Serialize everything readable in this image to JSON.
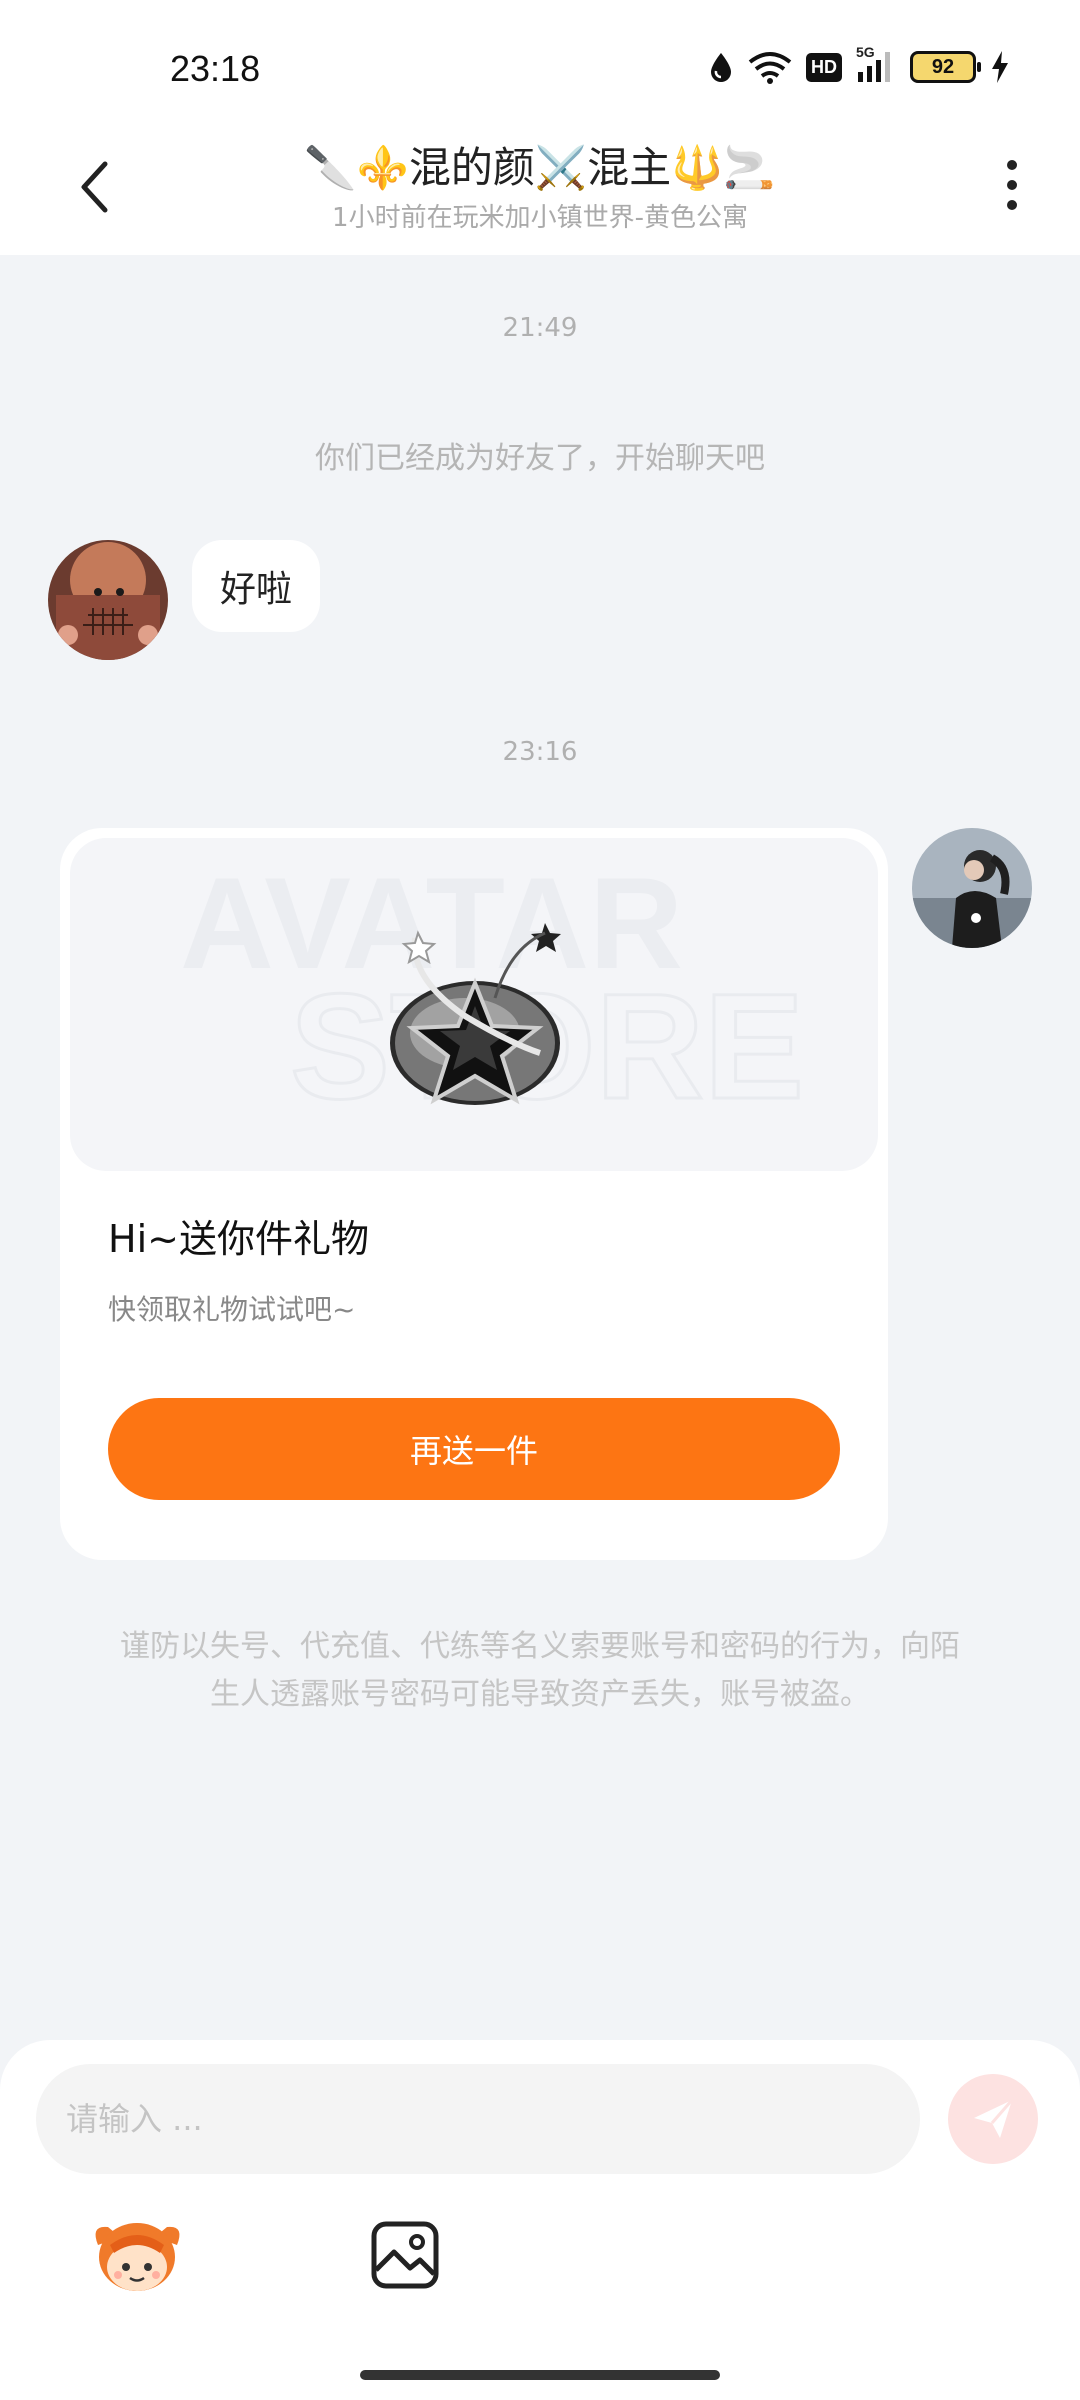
{
  "status_bar": {
    "time": "23:18",
    "network": "5G",
    "hd": "HD",
    "battery": "92"
  },
  "header": {
    "title": "🔪⚜️混的颜⚔️混主🔱🚬",
    "subtitle": "1小时前在玩米加小镇世界-黄色公寓"
  },
  "chat": {
    "time_1": "21:49",
    "system_message": "你们已经成为好友了，开始聊天吧",
    "message_1": "好啦",
    "time_2": "23:16",
    "gift": {
      "watermark_top": "AVATAR",
      "watermark_bottom": "STORE",
      "title": "Hi~送你件礼物",
      "description": "快领取礼物试试吧~",
      "button": "再送一件"
    },
    "warning": "谨防以失号、代充值、代练等名义索要账号和密码的行为，向陌生人透露账号密码可能导致资产丢失，账号被盗。"
  },
  "input": {
    "placeholder": "请输入 ..."
  },
  "colors": {
    "accent": "#fd7513",
    "background": "#f2f4f7",
    "send_disabled": "#fde2e1"
  }
}
